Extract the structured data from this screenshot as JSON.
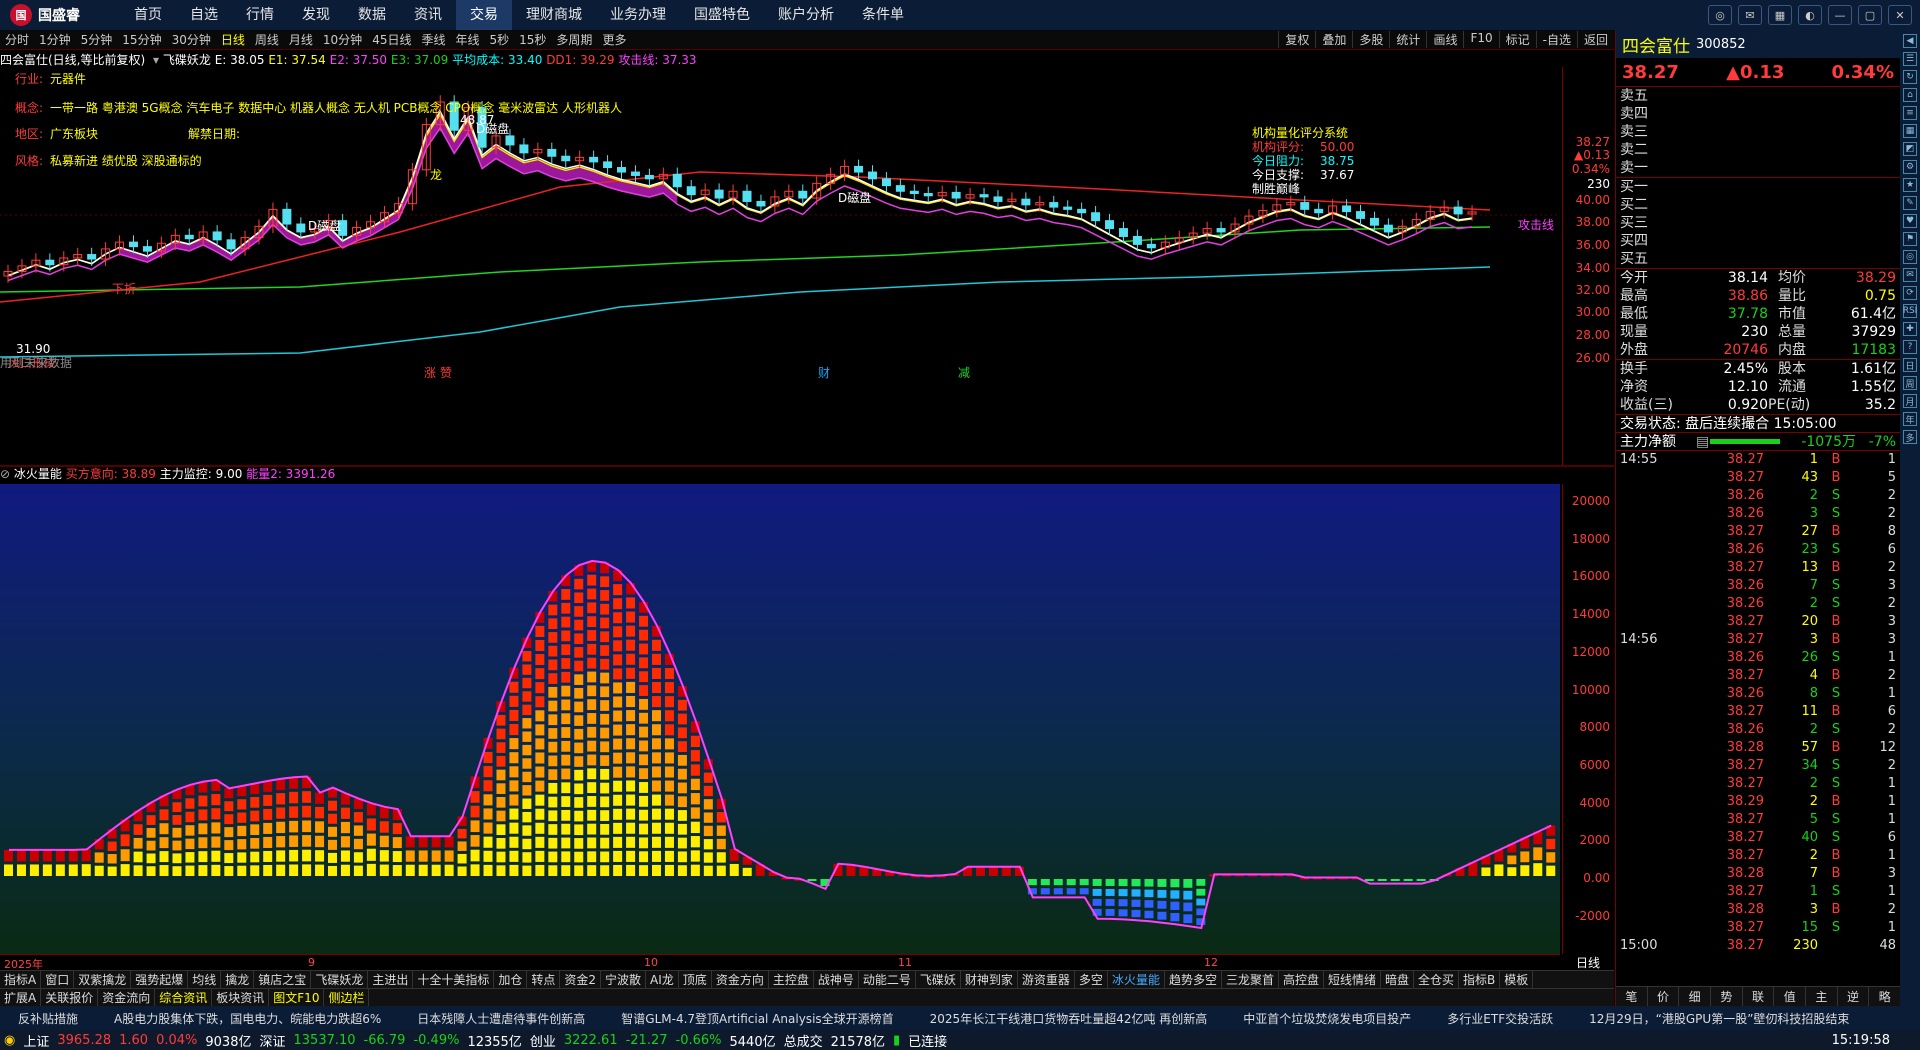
{
  "topbar": {
    "logo": "国盛睿",
    "logo_icon": "logo-icon",
    "nav": [
      "首页",
      "自选",
      "行情",
      "发现",
      "数据",
      "资讯",
      "交易",
      "理财商城",
      "业务办理",
      "国盛特色",
      "账户分析",
      "条件单"
    ],
    "active": "交易",
    "controls": [
      "chat-icon",
      "mail-icon",
      "grid-icon",
      "skin-icon",
      "min-icon",
      "max-icon",
      "close-icon"
    ]
  },
  "periods": {
    "items": [
      "分时",
      "1分钟",
      "5分钟",
      "15分钟",
      "30分钟",
      "日线",
      "周线",
      "月线",
      "10分钟",
      "45日线",
      "季线",
      "年线",
      "5秒",
      "15秒",
      "多周期",
      "更多"
    ],
    "active": "日线",
    "right": [
      "复权",
      "叠加",
      "多股",
      "统计",
      "画线",
      "F10",
      "标记",
      "-自选",
      "返回"
    ]
  },
  "info": {
    "title": "四会富仕(日线,等比前复权)",
    "indicator": "飞碟妖龙",
    "E": "E: 38.05",
    "E1": "E1: 37.54",
    "E2": "E2: 37.50",
    "E3": "E3: 37.09",
    "avgcost": "平均成本: 33.40",
    "DD1": "DD1: 39.29",
    "attack": "攻击线: 37.33"
  },
  "chart_labels": {
    "industry_label": "行业:",
    "industry": "元器件",
    "concept_label": "概念:",
    "concept": "一带一路 粤港澳 5G概念 汽车电子 数据中心 机器人概念 无人机 PCB概念 CPO概念 毫米波雷达 人形机器人",
    "region_label": "地区:",
    "region": "广东板块",
    "unlock_label": "解禁日期:",
    "style_label": "风格:",
    "style": "私募新进 绩优股 深股通标的",
    "high": "48.87",
    "low": "31.90",
    "dpan": "D磁盘",
    "dpan2": "D磁盘",
    "dpan3": "D磁盘",
    "xiazhe": "下折",
    "fengkou": "风口形成",
    "long": "龙",
    "proj": "用到未来数据",
    "events": [
      "涨",
      "赞",
      "财",
      "减"
    ],
    "attack_line": "攻击线"
  },
  "score": {
    "title": "机构量化评分系统",
    "score_label": "机构评分:",
    "score": "50.00",
    "resist_label": "今日阻力:",
    "resist": "38.75",
    "support_label": "今日支撑:",
    "support": "37.67",
    "tip": "制胜巅峰"
  },
  "yaxis1": [
    "38.27",
    "▲0.13",
    "0.34%",
    "230",
    "40.00",
    "38.00",
    "36.00",
    "34.00",
    "32.00",
    "30.00",
    "28.00",
    "26.00"
  ],
  "yaxis2": [
    "20000",
    "18000",
    "16000",
    "14000",
    "12000",
    "10000",
    "8000",
    "6000",
    "4000",
    "2000",
    "0.00",
    "-2000"
  ],
  "ind": {
    "name": "冰火量能",
    "buy": "买方意向: 38.89",
    "main": "主力监控: 9.00",
    "energy": "能量2: 3391.26"
  },
  "dates": [
    "2025年",
    "9",
    "10",
    "11",
    "12"
  ],
  "daily": "日线",
  "tabs1": [
    "指标A",
    "窗口",
    "双紫擒龙",
    "强势起爆",
    "均线",
    "擒龙",
    "镇店之宝",
    "飞碟妖龙",
    "主进出",
    "十全十美指标",
    "加仓",
    "转点",
    "资金2",
    "宁波散",
    "AI龙",
    "顶底",
    "资金方向",
    "主控盘",
    "战神号",
    "动能二号",
    "飞碟妖",
    "财神到家",
    "游资重器",
    "多空",
    "冰火量能",
    "趋势多空",
    "三龙聚首",
    "高控盘",
    "短线情绪",
    "暗盘",
    "全仓买",
    "指标B",
    "模板"
  ],
  "tabs1_active": "冰火量能",
  "tabs2": [
    "扩展A",
    "关联报价",
    "资金流向",
    "综合资讯",
    "板块资讯",
    "图文F10",
    "侧边栏"
  ],
  "news": [
    "反补贴措施",
    "A股电力股集体下跌，国电电力、皖能电力跌超6%",
    "日本残障人士遭虐待事件创新高",
    "智谱GLM-4.7登顶Artificial Analysis全球开源榜首",
    "2025年长江干线港口货物吞吐量超42亿吨 再创新高",
    "中亚首个垃圾焚烧发电项目投产",
    "多行业ETF交投活跃",
    "12月29日，“港股GPU第一股”壁仞科技招股结束"
  ],
  "status": {
    "sh_label": "上证",
    "sh": "3965.28",
    "sh_chg": "1.60",
    "sh_pct": "0.04%",
    "sh_amt": "9038亿",
    "sz_label": "深证",
    "sz": "13537.10",
    "sz_chg": "-66.79",
    "sz_pct": "-0.49%",
    "sz_amt": "12355亿",
    "cy_label": "创业",
    "cy": "3222.61",
    "cy_chg": "-21.27",
    "cy_pct": "-0.66%",
    "cy_amt": "5440亿",
    "total_label": "总成交",
    "total": "21578亿",
    "conn": "已连接",
    "time": "15:19:58"
  },
  "quote": {
    "name": "四会富仕",
    "code": "300852",
    "price": "38.27",
    "chg": "▲0.13",
    "pct": "0.34%",
    "sells": [
      "卖五",
      "卖四",
      "卖三",
      "卖二",
      "卖一"
    ],
    "buys": [
      "买一",
      "买二",
      "买三",
      "买四",
      "买五"
    ],
    "stats": [
      [
        "今开",
        "38.14",
        "均价",
        "38.29"
      ],
      [
        "最高",
        "38.86",
        "量比",
        "0.75"
      ],
      [
        "最低",
        "37.78",
        "市值",
        "61.4亿"
      ],
      [
        "现量",
        "230",
        "总量",
        "37929"
      ],
      [
        "外盘",
        "20746",
        "内盘",
        "17183"
      ]
    ],
    "stats2": [
      [
        "换手",
        "2.45%",
        "股本",
        "1.61亿"
      ],
      [
        "净资",
        "12.10",
        "流通",
        "1.55亿"
      ],
      [
        "收益(三)",
        "0.920",
        "PE(动)",
        "35.2"
      ]
    ],
    "trade_state": "交易状态: 盘后连续撮合 15:05:00",
    "net_label": "主力净额",
    "net": "-1075万",
    "net_pct": "-7%"
  },
  "ticks": [
    [
      "14:55",
      "38.27",
      "1",
      "B",
      "1"
    ],
    [
      "",
      "38.27",
      "43",
      "B",
      "5"
    ],
    [
      "",
      "38.26",
      "2",
      "S",
      "2"
    ],
    [
      "",
      "38.26",
      "3",
      "S",
      "2"
    ],
    [
      "",
      "38.27",
      "27",
      "B",
      "8"
    ],
    [
      "",
      "38.26",
      "23",
      "S",
      "6"
    ],
    [
      "",
      "38.27",
      "13",
      "B",
      "2"
    ],
    [
      "",
      "38.26",
      "7",
      "S",
      "3"
    ],
    [
      "",
      "38.26",
      "2",
      "S",
      "2"
    ],
    [
      "",
      "38.27",
      "20",
      "B",
      "3"
    ],
    [
      "14:56",
      "38.27",
      "3",
      "B",
      "3"
    ],
    [
      "",
      "38.26",
      "26",
      "S",
      "1"
    ],
    [
      "",
      "38.27",
      "4",
      "B",
      "2"
    ],
    [
      "",
      "38.26",
      "8",
      "S",
      "1"
    ],
    [
      "",
      "38.27",
      "11",
      "B",
      "6"
    ],
    [
      "",
      "38.26",
      "2",
      "S",
      "2"
    ],
    [
      "",
      "38.28",
      "57",
      "B",
      "12"
    ],
    [
      "",
      "38.27",
      "34",
      "S",
      "2"
    ],
    [
      "",
      "38.27",
      "2",
      "S",
      "1"
    ],
    [
      "",
      "38.29",
      "2",
      "B",
      "1"
    ],
    [
      "",
      "38.27",
      "5",
      "S",
      "1"
    ],
    [
      "",
      "38.27",
      "40",
      "S",
      "6"
    ],
    [
      "",
      "38.27",
      "2",
      "B",
      "1"
    ],
    [
      "",
      "38.28",
      "7",
      "B",
      "3"
    ],
    [
      "",
      "38.27",
      "1",
      "S",
      "1"
    ],
    [
      "",
      "38.28",
      "3",
      "B",
      "2"
    ],
    [
      "",
      "38.27",
      "15",
      "S",
      "1"
    ],
    [
      "15:00",
      "38.27",
      "230",
      "",
      "48"
    ]
  ],
  "rtabs": [
    "笔",
    "价",
    "细",
    "势",
    "联",
    "值",
    "主",
    "逆",
    "略"
  ],
  "side": [
    "◀",
    "☰",
    "↻",
    "⌂",
    "≡",
    "▦",
    "◩",
    "⚙",
    "★",
    "✎",
    "♥",
    "⚑",
    "◎",
    "✉",
    "⟳",
    "RSI",
    "✚",
    "?",
    "日",
    "周",
    "月",
    "年",
    "多"
  ]
}
